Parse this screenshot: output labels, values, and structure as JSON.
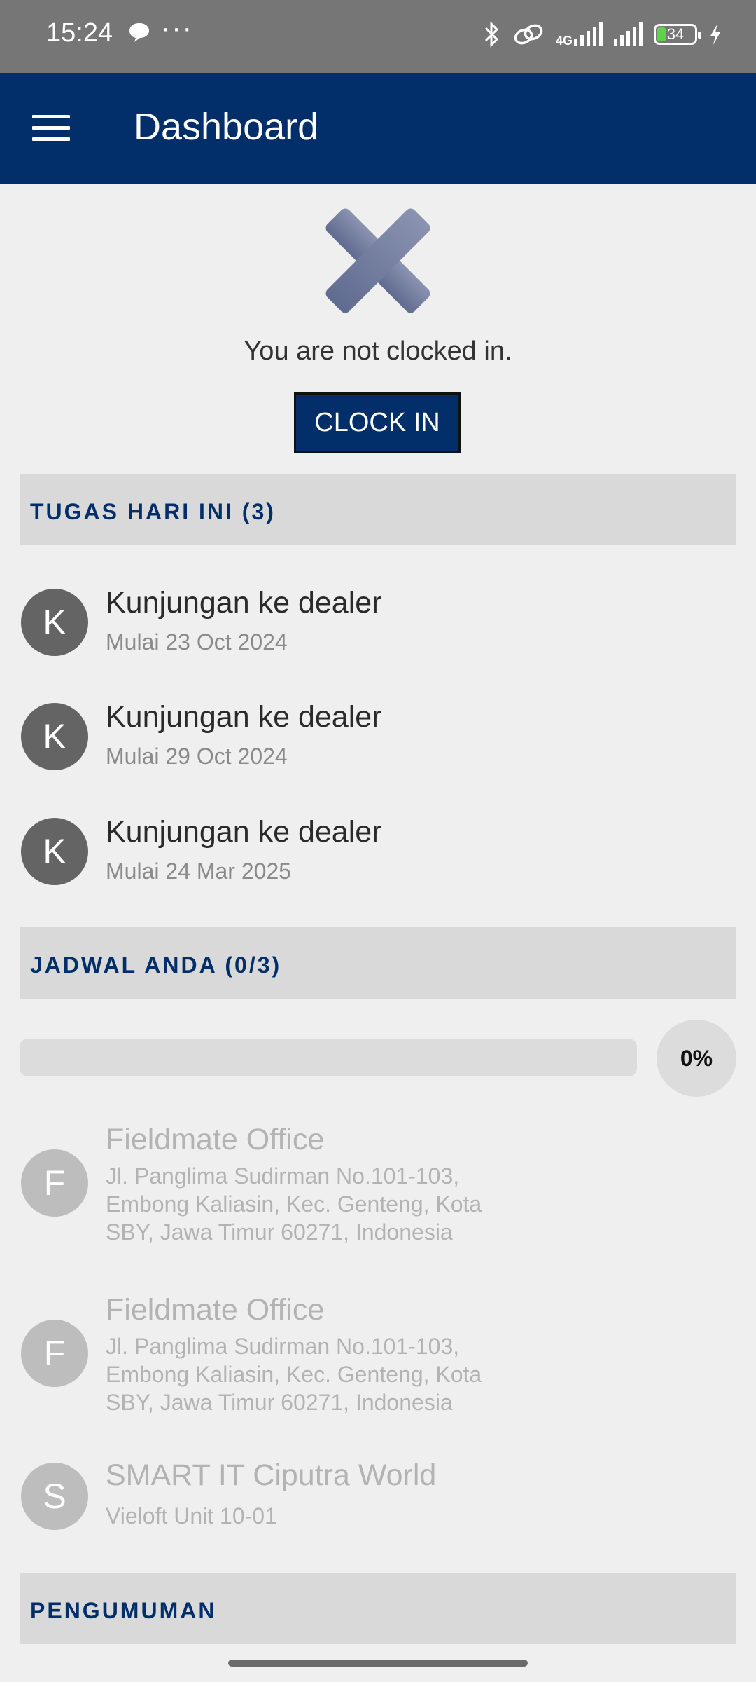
{
  "status_bar": {
    "time": "15:24",
    "dots": "···",
    "network": "4G",
    "battery": "34"
  },
  "app_bar": {
    "title": "Dashboard"
  },
  "clock": {
    "message": "You are not clocked in.",
    "button_label": "CLOCK IN"
  },
  "tasks": {
    "header": "TUGAS HARI INI (3)",
    "items": [
      {
        "initial": "K",
        "title": "Kunjungan ke dealer",
        "subtitle": "Mulai 23 Oct 2024"
      },
      {
        "initial": "K",
        "title": "Kunjungan ke dealer",
        "subtitle": "Mulai 29 Oct 2024"
      },
      {
        "initial": "K",
        "title": "Kunjungan ke dealer",
        "subtitle": "Mulai 24 Mar 2025"
      }
    ]
  },
  "schedule": {
    "header": "JADWAL ANDA (0/3)",
    "progress": 0,
    "progress_label": "0%",
    "items": [
      {
        "initial": "F",
        "title": "Fieldmate Office",
        "address": [
          "Jl. Panglima Sudirman No.101-103,",
          "Embong Kaliasin, Kec. Genteng, Kota",
          "SBY, Jawa Timur 60271, Indonesia"
        ]
      },
      {
        "initial": "F",
        "title": "Fieldmate Office",
        "address": [
          "Jl. Panglima Sudirman No.101-103,",
          "Embong Kaliasin, Kec. Genteng, Kota",
          "SBY, Jawa Timur 60271, Indonesia"
        ]
      },
      {
        "initial": "S",
        "title": "SMART IT Ciputra World",
        "address": [
          "Vieloft Unit 10-01"
        ]
      }
    ]
  },
  "announcements": {
    "header": "PENGUMUMAN"
  },
  "colors": {
    "primary": "#022f69",
    "background": "#efefef",
    "section": "#d9d9d9"
  }
}
